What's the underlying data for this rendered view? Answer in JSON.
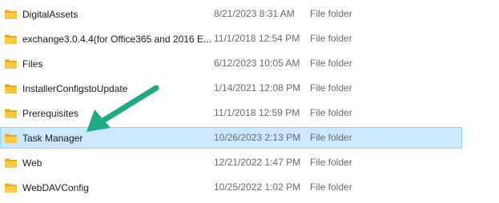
{
  "files": [
    {
      "name": "DigitalAssets",
      "date": "8/21/2023 8:31 AM",
      "type": "File folder",
      "icon": "folder-icon"
    },
    {
      "name": "exchange3.0.4.4(for Office365 and 2016 E...",
      "date": "11/1/2018 12:54 PM",
      "type": "File folder",
      "icon": "folder-icon"
    },
    {
      "name": "Files",
      "date": "6/12/2023 10:05 AM",
      "type": "File folder",
      "icon": "folder-icon"
    },
    {
      "name": "InstallerConfigstoUpdate",
      "date": "1/14/2021 12:08 PM",
      "type": "File folder",
      "icon": "folder-icon"
    },
    {
      "name": "Prerequisites",
      "date": "11/1/2018 12:59 PM",
      "type": "File folder",
      "icon": "folder-icon"
    },
    {
      "name": "Task Manager",
      "date": "10/26/2023 2:13 PM",
      "type": "File folder",
      "icon": "folder-icon",
      "selected": true
    },
    {
      "name": "Web",
      "date": "12/21/2022 1:47 PM",
      "type": "File folder",
      "icon": "folder-icon"
    },
    {
      "name": "WebDAVConfig",
      "date": "10/25/2022 1:02 PM",
      "type": "File folder",
      "icon": "folder-icon"
    }
  ],
  "colors": {
    "selection_fill": "#cce8ff",
    "selection_border": "#99d1ff",
    "arrow": "#1fa987",
    "folder": "#f7c948"
  }
}
